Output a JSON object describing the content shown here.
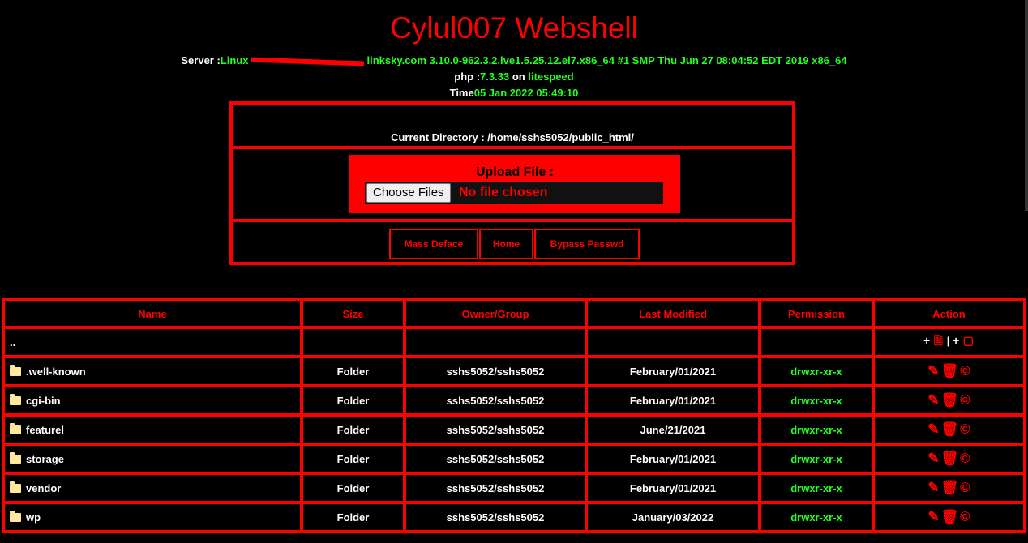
{
  "title": "Cylul007 Webshell",
  "server": {
    "label": "Server :",
    "os": "Linux",
    "host_tail": "linksky.com",
    "kernel": "3.10.0-962.3.2.lve1.5.25.12.el7.x86_64 #1 SMP Thu Jun 27 08:04:52 EDT 2019 x86_64"
  },
  "php": {
    "label": "php :",
    "version": "7.3.33",
    "on": "on",
    "server": "litespeed"
  },
  "time": {
    "label": "Time",
    "value": "05 Jan 2022 05:49:10"
  },
  "current_directory": "Current Directory : /home/sshs5052/public_html/",
  "upload": {
    "label": "Upload File :",
    "button": "Choose Files",
    "status": "No file chosen"
  },
  "nav": [
    "Mass Deface",
    "Home",
    "Bypass Passwd"
  ],
  "table": {
    "headers": [
      "Name",
      "Size",
      "Owner/Group",
      "Last Modified",
      "Permission",
      "Action"
    ],
    "parent": "..",
    "rows": [
      {
        "name": ".well-known",
        "size": "Folder",
        "owner": "sshs5052/sshs5052",
        "modified": "February/01/2021",
        "perm": "drwxr-xr-x"
      },
      {
        "name": "cgi-bin",
        "size": "Folder",
        "owner": "sshs5052/sshs5052",
        "modified": "February/01/2021",
        "perm": "drwxr-xr-x"
      },
      {
        "name": "featurel",
        "size": "Folder",
        "owner": "sshs5052/sshs5052",
        "modified": "June/21/2021",
        "perm": "drwxr-xr-x"
      },
      {
        "name": "storage",
        "size": "Folder",
        "owner": "sshs5052/sshs5052",
        "modified": "February/01/2021",
        "perm": "drwxr-xr-x"
      },
      {
        "name": "vendor",
        "size": "Folder",
        "owner": "sshs5052/sshs5052",
        "modified": "February/01/2021",
        "perm": "drwxr-xr-x"
      },
      {
        "name": "wp",
        "size": "Folder",
        "owner": "sshs5052/sshs5052",
        "modified": "January/03/2022",
        "perm": "drwxr-xr-x"
      }
    ]
  },
  "icons": {
    "edit": "pencil-icon",
    "delete": "trash-icon",
    "copy": "copyright-icon",
    "new_file": "file-icon",
    "new_folder": "folder-icon"
  },
  "colors": {
    "accent": "#ff0000",
    "highlight": "#22ff22",
    "background": "#000000"
  }
}
